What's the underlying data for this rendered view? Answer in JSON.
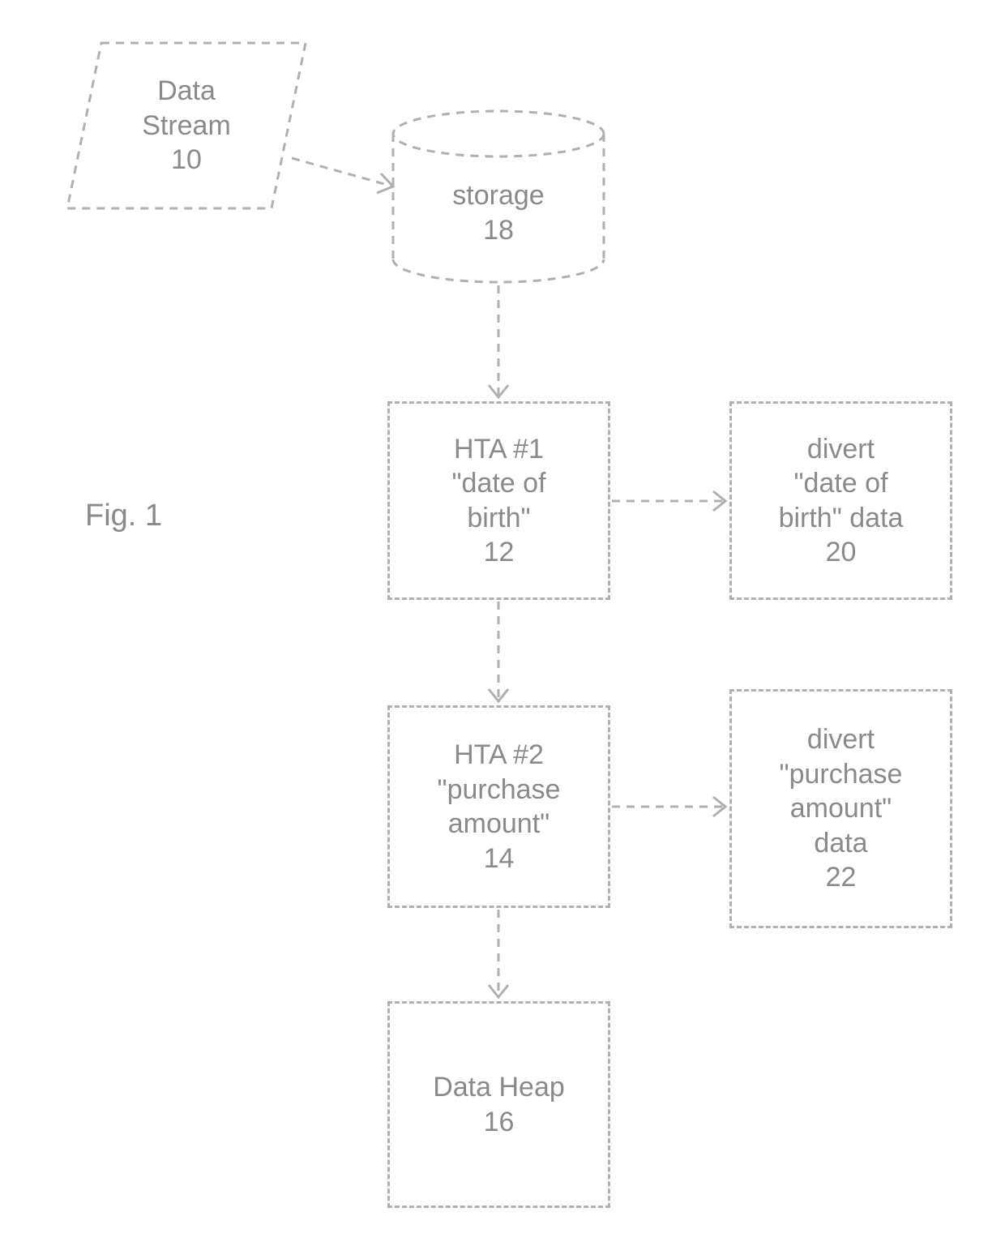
{
  "figure_label": "Fig. 1",
  "nodes": {
    "data_stream": {
      "line1": "Data",
      "line2": "Stream",
      "id": "10"
    },
    "storage": {
      "label": "storage",
      "id": "18"
    },
    "hta1": {
      "line1": "HTA #1",
      "line2": "\"date of",
      "line3": "birth\"",
      "id": "12"
    },
    "divert1": {
      "line1": "divert",
      "line2": "\"date of",
      "line3": "birth\" data",
      "id": "20"
    },
    "hta2": {
      "line1": "HTA #2",
      "line2": "\"purchase",
      "line3": "amount\"",
      "id": "14"
    },
    "divert2": {
      "line1": "divert",
      "line2": "\"purchase",
      "line3": "amount\"",
      "line4": "data",
      "id": "22"
    },
    "data_heap": {
      "line1": "Data Heap",
      "id": "16"
    }
  }
}
